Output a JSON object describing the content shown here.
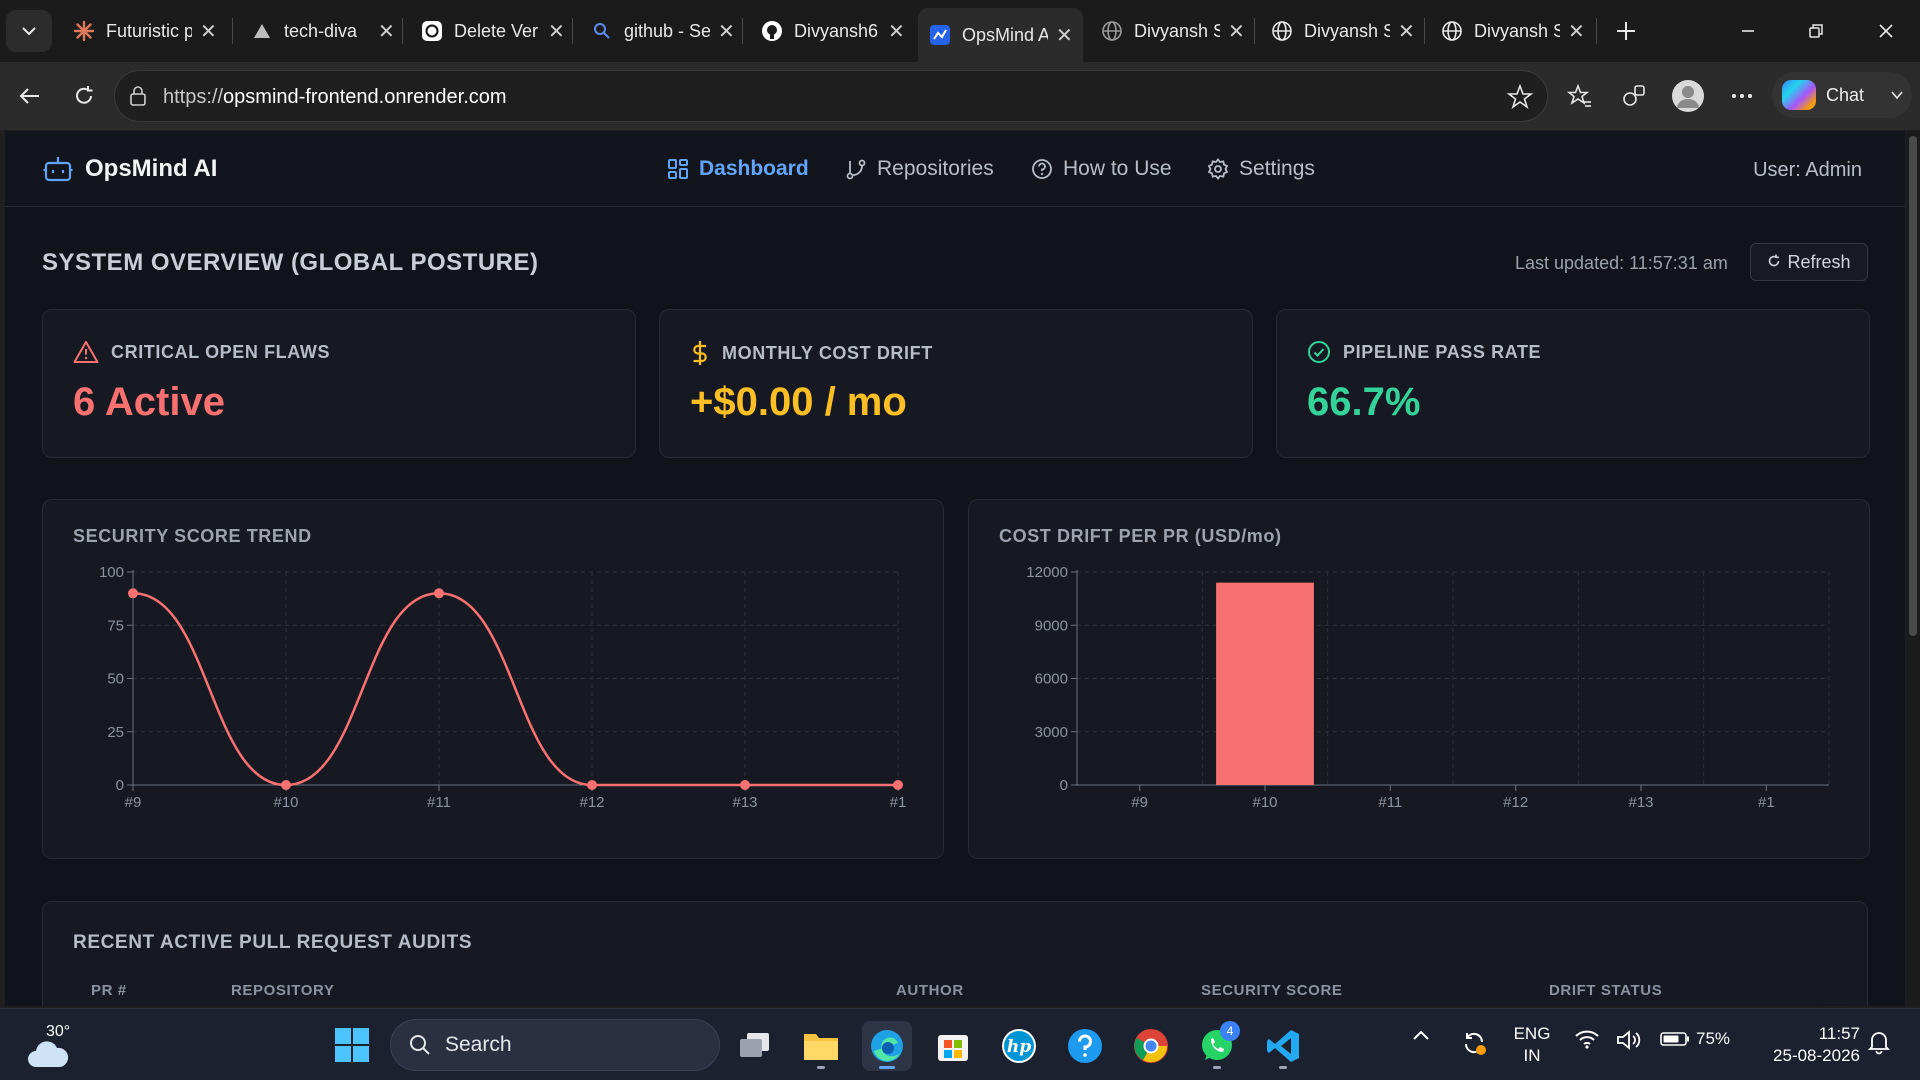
{
  "browser": {
    "tabs": [
      {
        "label": "Futuristic p",
        "icon": "claude-icon"
      },
      {
        "label": "tech-diva",
        "icon": "vercel-icon"
      },
      {
        "label": "Delete Ver",
        "icon": "openai-icon"
      },
      {
        "label": "github - Se",
        "icon": "search-icon"
      },
      {
        "label": "Divyansh6",
        "icon": "github-icon"
      },
      {
        "label": "OpsMind A",
        "icon": "opsmind-icon",
        "active": true
      },
      {
        "label": "Divyansh S",
        "icon": "globe-icon"
      },
      {
        "label": "Divyansh S",
        "icon": "globe-icon"
      },
      {
        "label": "Divyansh S",
        "icon": "globe-icon"
      }
    ],
    "url_prefix": "https://",
    "url_host": "opsmind-frontend.onrender.com",
    "chat_label": "Chat"
  },
  "app": {
    "brand": "OpsMind AI",
    "nav": {
      "dashboard": "Dashboard",
      "repositories": "Repositories",
      "how_to_use": "How to Use",
      "settings": "Settings"
    },
    "user": "User: Admin",
    "page_title": "SYSTEM OVERVIEW (GLOBAL POSTURE)",
    "last_updated": "Last updated: 11:57:31 am",
    "refresh_label": "Refresh",
    "stats": {
      "critical": {
        "label": "CRITICAL OPEN FLAWS",
        "value": "6 Active",
        "color": "#f87171"
      },
      "cost": {
        "label": "MONTHLY COST DRIFT",
        "value": "+$0.00 / mo",
        "color": "#fbbf24"
      },
      "pipeline": {
        "label": "PIPELINE PASS RATE",
        "value": "66.7%",
        "color": "#34d399"
      }
    },
    "table": {
      "title": "RECENT ACTIVE PULL REQUEST AUDITS",
      "headers": [
        "PR #",
        "REPOSITORY",
        "AUTHOR",
        "SECURITY SCORE",
        "DRIFT STATUS"
      ]
    }
  },
  "chart_data": [
    {
      "type": "line",
      "title": "SECURITY SCORE TREND",
      "categories": [
        "#9",
        "#10",
        "#11",
        "#12",
        "#13",
        "#1"
      ],
      "values": [
        90,
        0,
        90,
        0,
        0,
        0
      ],
      "yticks": [
        0,
        25,
        50,
        75,
        100
      ],
      "ylim": [
        0,
        100
      ],
      "color": "#f87171",
      "grid": true
    },
    {
      "type": "bar",
      "title": "COST DRIFT PER PR (USD/mo)",
      "categories": [
        "#9",
        "#10",
        "#11",
        "#12",
        "#13",
        "#1"
      ],
      "values": [
        0,
        11400,
        0,
        0,
        0,
        0
      ],
      "yticks": [
        0,
        3000,
        6000,
        9000,
        12000
      ],
      "ylim": [
        0,
        12000
      ],
      "color": "#f87171",
      "grid": true
    }
  ],
  "taskbar": {
    "temperature": "30°",
    "search_label": "Search",
    "whatsapp_badge": "4",
    "battery": "75%",
    "lang_line1": "ENG",
    "lang_line2": "IN",
    "time": "11:57",
    "date": "25-08-2026"
  }
}
